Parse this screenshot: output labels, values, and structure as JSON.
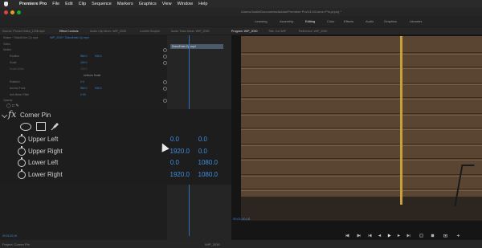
{
  "menubar": {
    "app_name": "Premiere Pro",
    "items": [
      "File",
      "Edit",
      "Clip",
      "Sequence",
      "Markers",
      "Graphics",
      "View",
      "Window",
      "Help"
    ]
  },
  "titlebar": {
    "title": "/Users/Justin/Documents/Adobe/Premiere Pro/13.0/Corner Pin.prproj *"
  },
  "workspaces": [
    "Learning",
    "Assembly",
    "Editing",
    "Color",
    "Effects",
    "Audio",
    "Graphics",
    "Libraries"
  ],
  "panels": {
    "left_tabs": [
      "Source: Pinned Video_1238.mp4",
      "Effect Controls",
      "Audio Clip Mixer: WIP_2030",
      "Lumetri Scopes",
      "Audio Track Mixer: WIP_2030"
    ],
    "source_path": "Master * DiasoEnter-Cp.mp4",
    "sequence_clip": "WIP_2030 * DiasoEnter-Cp.mp4",
    "timeline_clip": "DiasoEnter-Cp.mp4",
    "program_tabs": [
      "Program: WIP_2030",
      "Title: Cut WIP",
      "Reference: WIP_2030"
    ]
  },
  "effect_controls": {
    "section_video": "Video",
    "motion_label": "Motion",
    "position_label": "Position",
    "position_values": [
      "960.0",
      "540.0"
    ],
    "scale_label": "Scale",
    "scale_value": "100.0",
    "scale_width_label": "Scale Width",
    "scale_width_value": "100.0",
    "uniform_scale": "Uniform Scale",
    "rotation_label": "Rotation",
    "rotation_value": "0.0",
    "anchor_label": "Anchor Point",
    "anchor_values": [
      "960.0",
      "540.0"
    ],
    "antiflicker_label": "Anti-flicker Filter",
    "antiflicker_value": "0.00",
    "opacity_label": "Opacity",
    "fx_symbol": "fx",
    "effect_name": "Corner Pin",
    "rows": [
      {
        "label": "Upper Left",
        "x": "0.0",
        "y": "0.0"
      },
      {
        "label": "Upper Right",
        "x": "1920.0",
        "y": "0.0"
      },
      {
        "label": "Lower Left",
        "x": "0.0",
        "y": "1080.0"
      },
      {
        "label": "Lower Right",
        "x": "1920.0",
        "y": "1080.0"
      }
    ]
  },
  "program": {
    "timecode": "00;01;30;18",
    "current_time": "00;01;30;18"
  },
  "status": {
    "project_label": "Project: Corner Pin",
    "sequence_label": "WIP_2030"
  },
  "colors": {
    "accent": "#3f8ee0",
    "background": "#1d1d1d"
  },
  "icons": [
    "apple-icon",
    "ellipse-mask-icon",
    "rectangle-mask-icon",
    "pen-mask-icon",
    "stopwatch-icon",
    "play-icon",
    "step-back-icon",
    "step-forward-icon",
    "mouse-cursor-icon"
  ]
}
